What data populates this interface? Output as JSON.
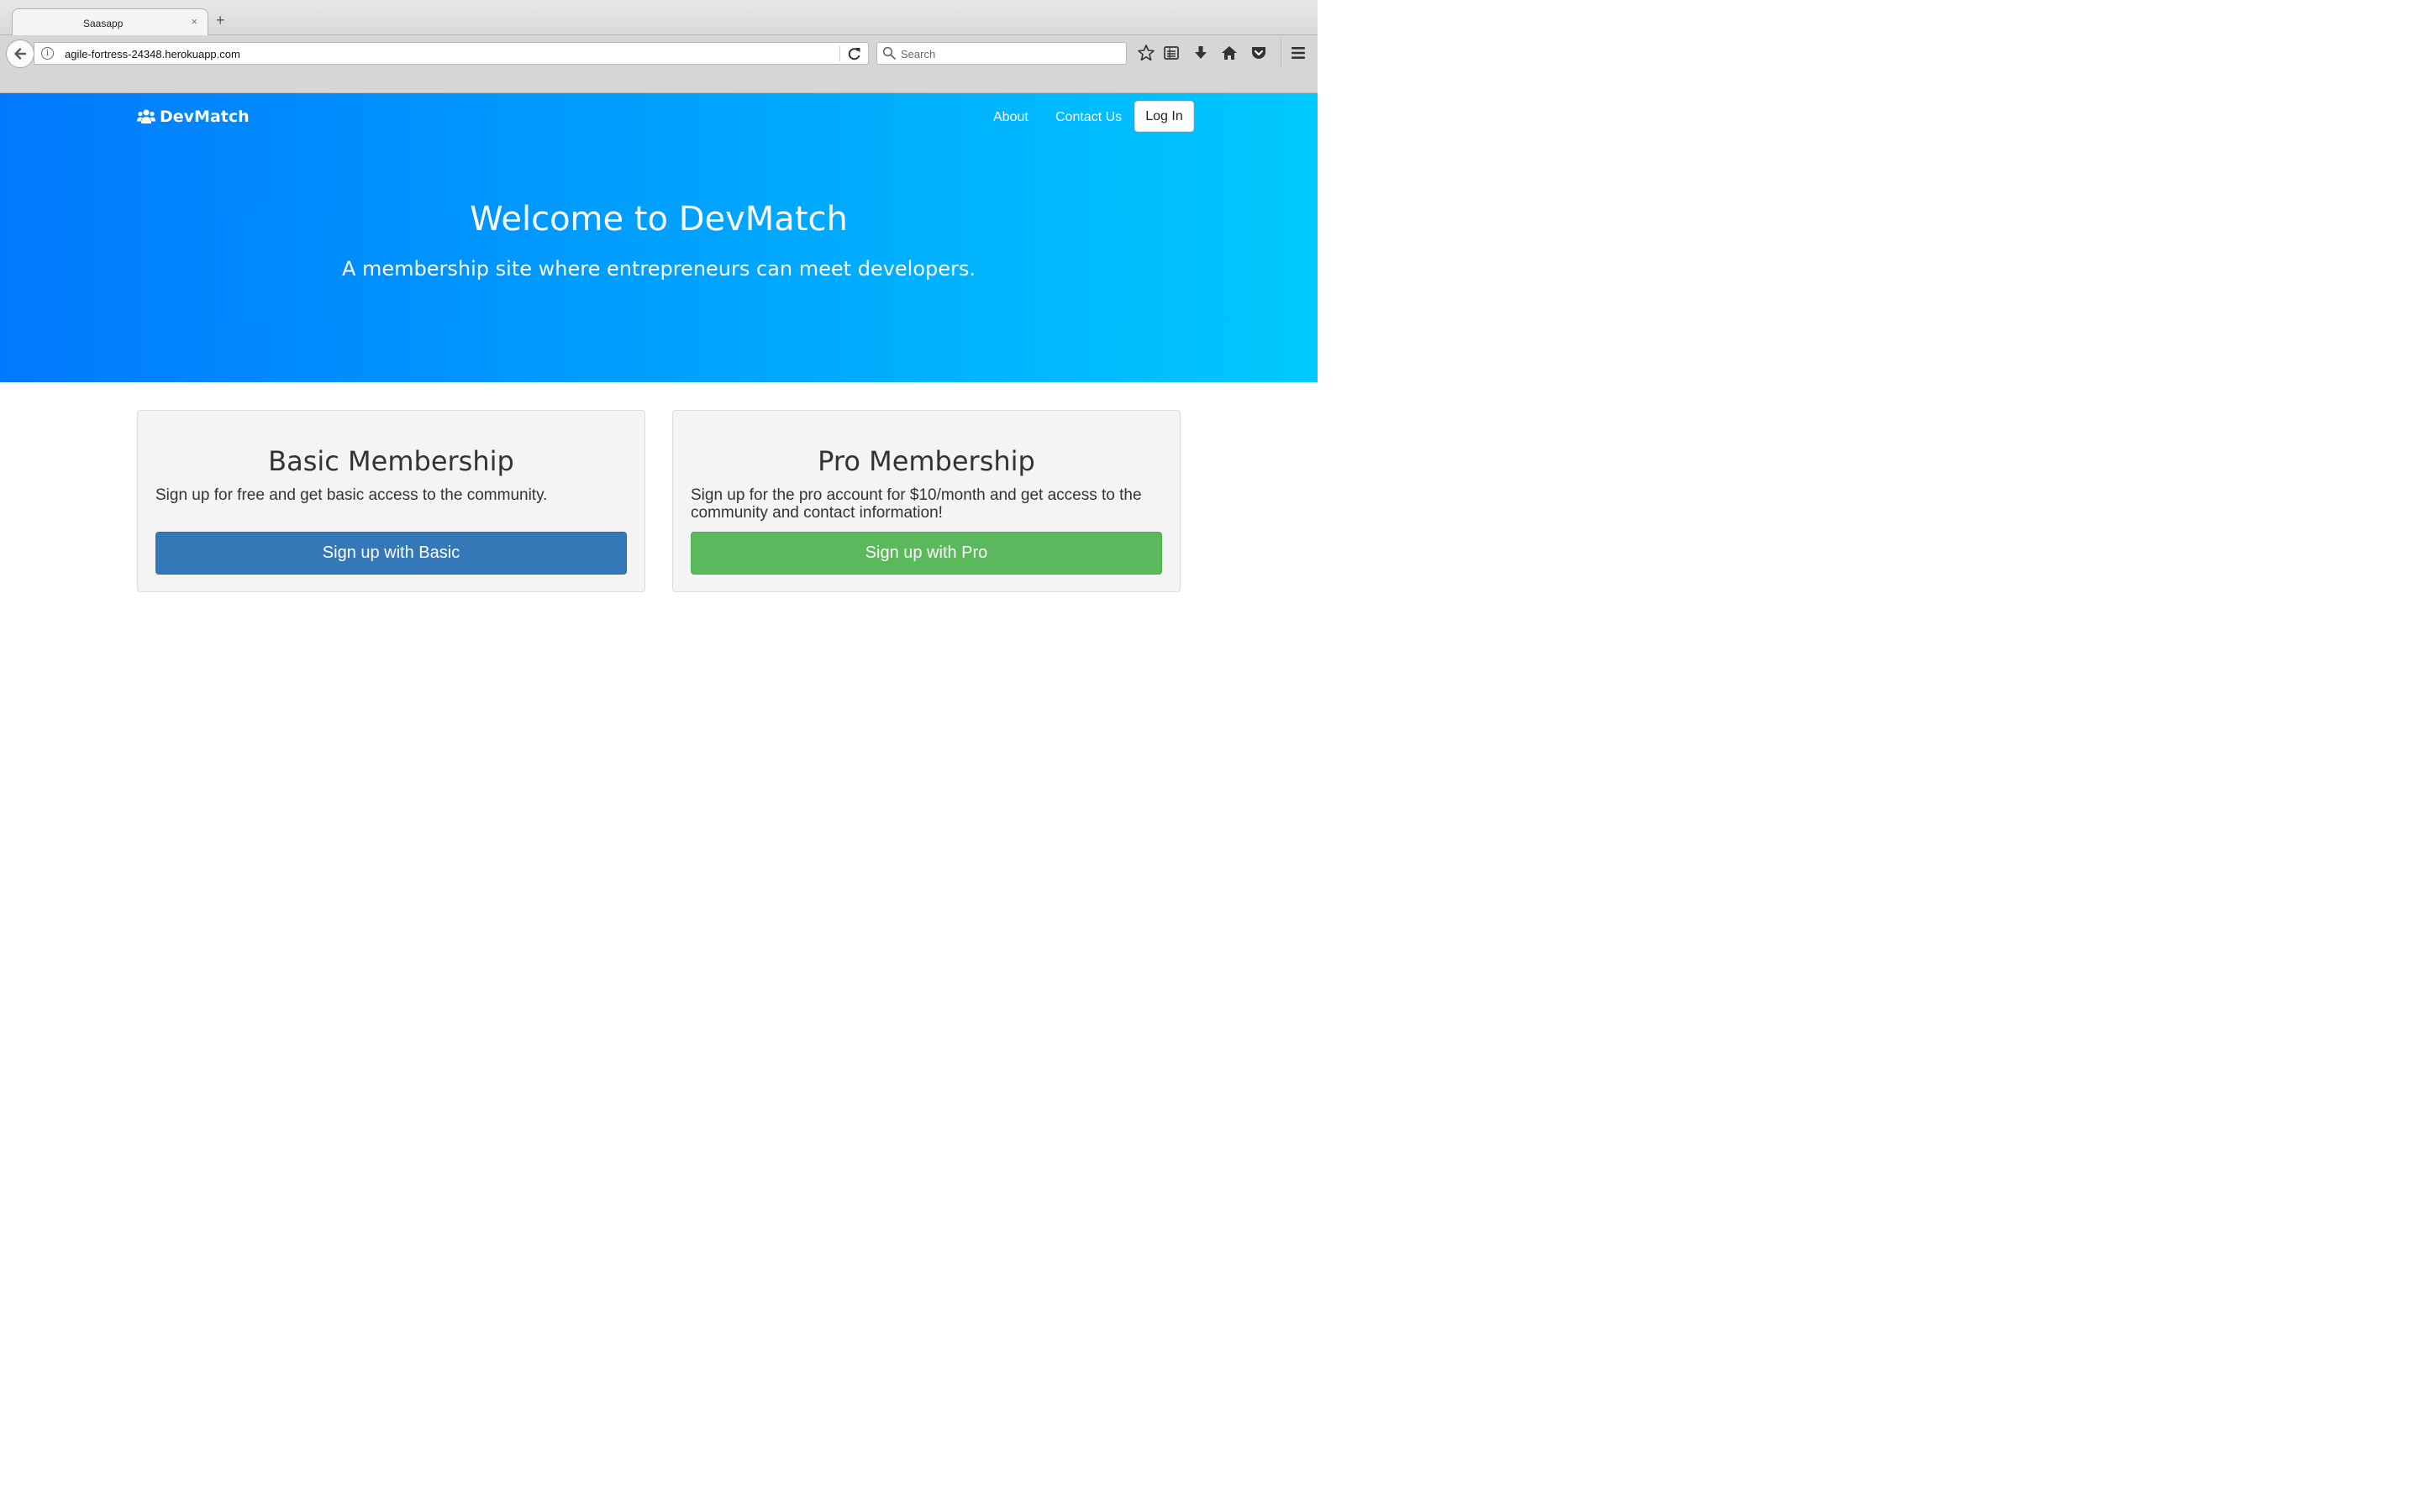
{
  "browser": {
    "tab_title": "Saasapp",
    "tab_close": "×",
    "new_tab": "+",
    "url": "agile-fortress-24348.herokuapp.com",
    "search_placeholder": "Search",
    "icons": [
      "back-arrow-icon",
      "info-icon",
      "reload-icon",
      "search-icon",
      "bookmark-star-icon",
      "reading-list-icon",
      "download-icon",
      "home-icon",
      "pocket-icon",
      "hamburger-menu-icon"
    ]
  },
  "site": {
    "brand": "DevMatch",
    "nav": {
      "about": "About",
      "contact": "Contact Us",
      "login": "Log In"
    },
    "hero": {
      "title": "Welcome to DevMatch",
      "subtitle": "A membership site where entrepreneurs can meet developers.",
      "gradient_start": "#0179fe",
      "gradient_end": "#00c9fe"
    },
    "plans": [
      {
        "title": "Basic Membership",
        "description": "Sign up for free and get basic access to the community.",
        "button": "Sign up with Basic",
        "button_color": "#3478b7"
      },
      {
        "title": "Pro Membership",
        "description": "Sign up for the pro account for $10/month and get access to the community and contact information!",
        "button": "Sign up with Pro",
        "button_color": "#5cb85c"
      }
    ]
  }
}
